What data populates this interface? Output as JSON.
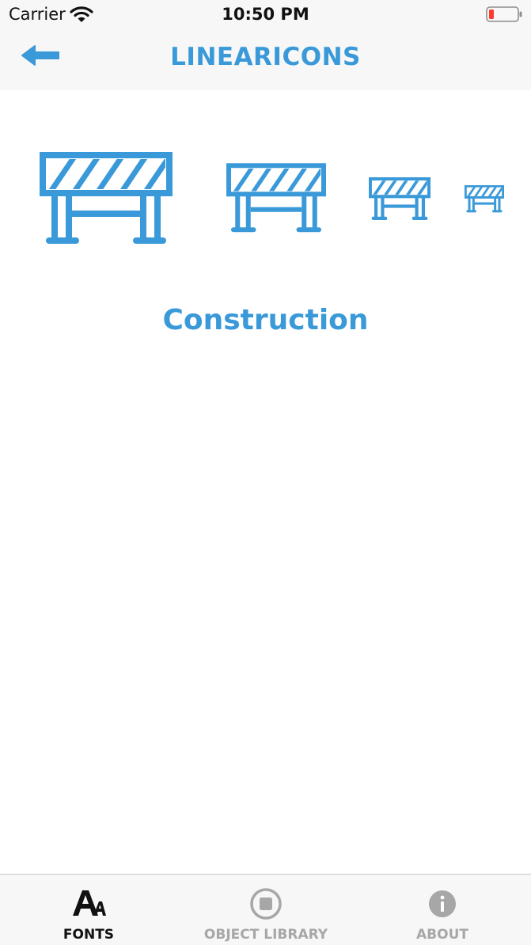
{
  "status_bar": {
    "carrier": "Carrier",
    "time": "10:50 PM",
    "battery_level": "low"
  },
  "nav": {
    "title": "LINEARICONS",
    "back_icon": "arrow-left-icon"
  },
  "detail": {
    "icon_name": "Construction",
    "icon": "construction-barrier-icon",
    "sizes": [
      "xlarge",
      "large",
      "medium",
      "small"
    ]
  },
  "tabs": [
    {
      "label": "FONTS",
      "icon": "fonts-icon",
      "active": true
    },
    {
      "label": "OBJECT LIBRARY",
      "icon": "object-library-icon",
      "active": false
    },
    {
      "label": "ABOUT",
      "icon": "info-icon",
      "active": false
    }
  ],
  "colors": {
    "accent": "#3a99d8",
    "bar_background": "#f7f7f7",
    "tab_active": "#111111",
    "tab_inactive": "#a7a7a7",
    "battery_low": "#ff3b30"
  }
}
